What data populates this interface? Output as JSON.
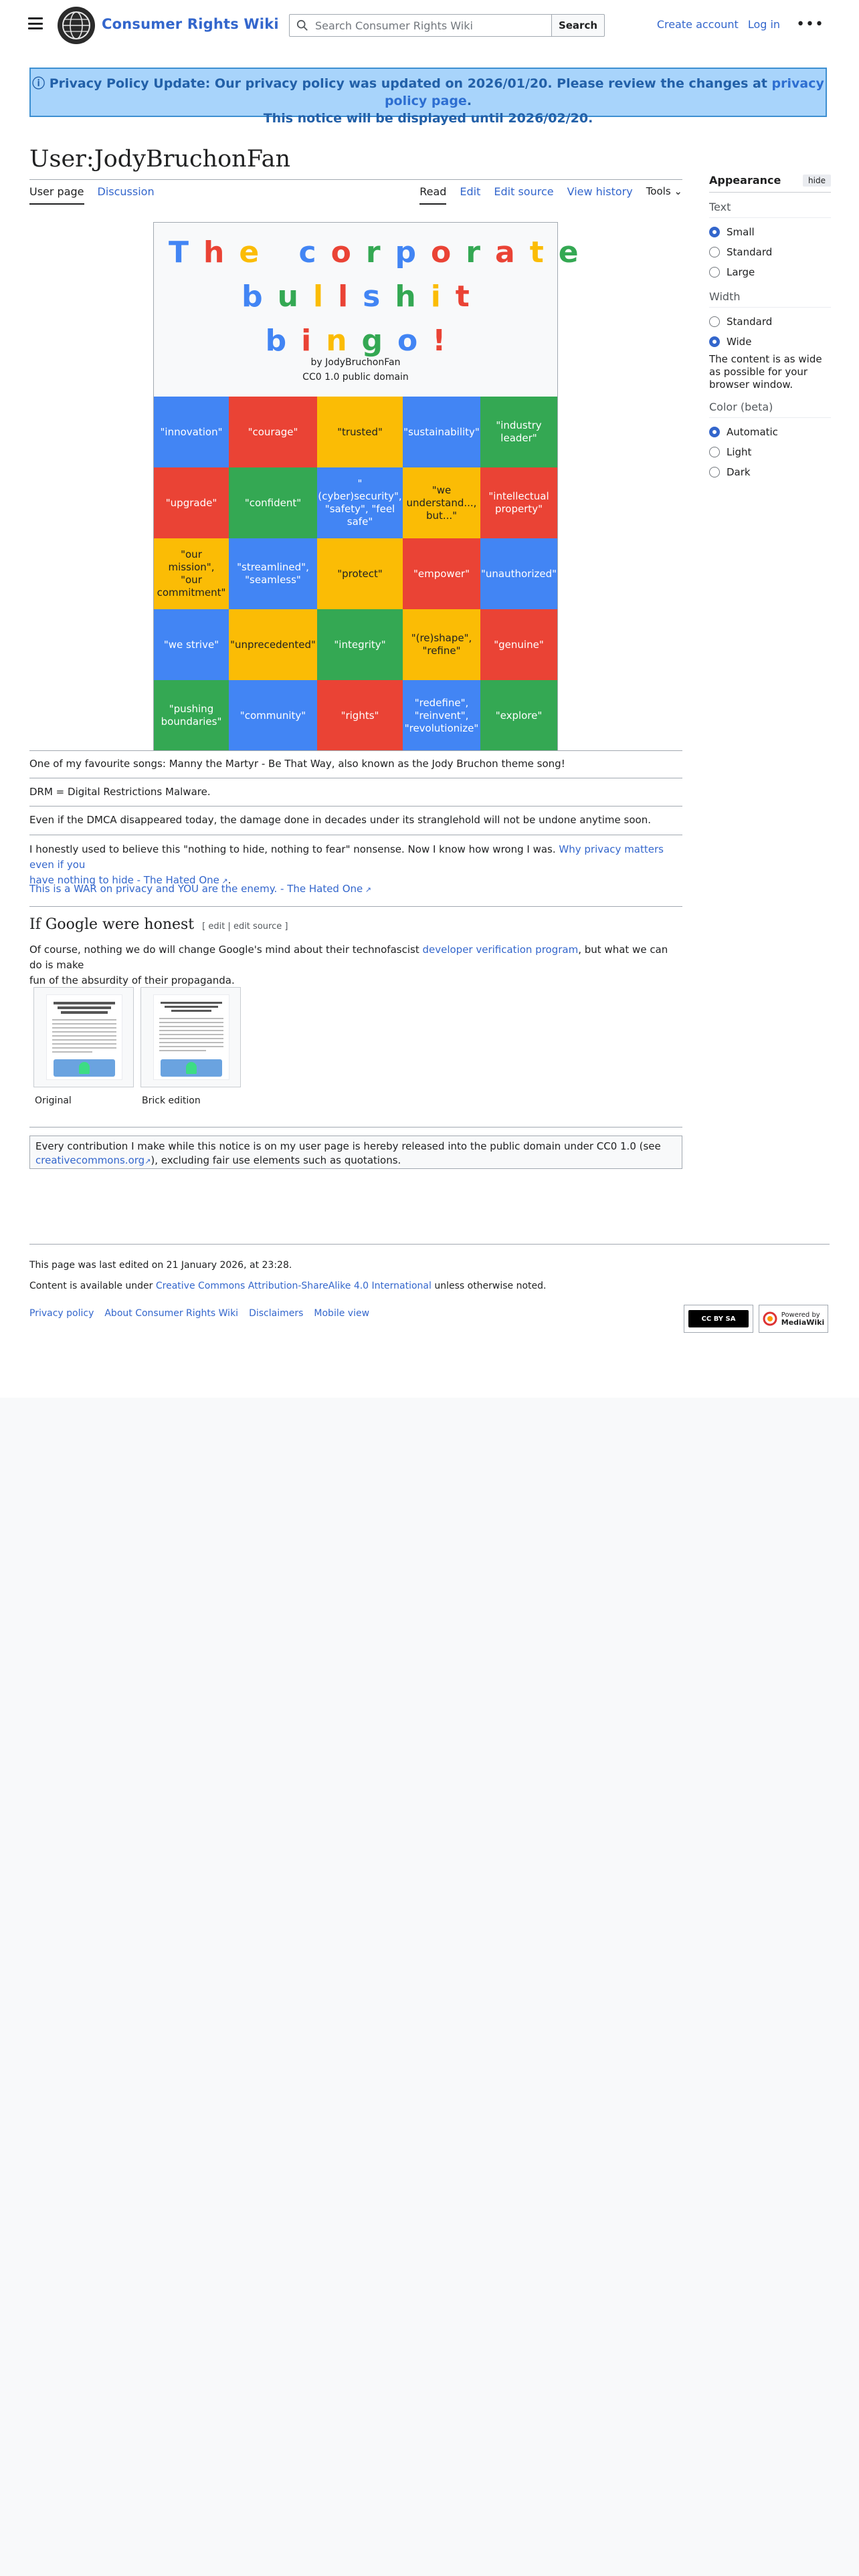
{
  "header": {
    "site_name": "Consumer Rights Wiki",
    "search_placeholder": "Search Consumer Rights Wiki",
    "search_button": "Search",
    "create_account": "Create account",
    "log_in": "Log in"
  },
  "notice": {
    "line1_prefix": "ⓘ Privacy Policy Update: Our privacy policy was updated on 2026/01/20. Please review the changes at ",
    "line1_link": "privacy policy page",
    "line1_suffix": ".",
    "line2": "This notice will be displayed until 2026/02/20."
  },
  "page": {
    "title": "User:JodyBruchonFan",
    "tabs_left": [
      "User page",
      "Discussion"
    ],
    "tabs_right": [
      "Read",
      "Edit",
      "Edit source",
      "View history"
    ],
    "tools": "Tools"
  },
  "appearance": {
    "title": "Appearance",
    "hide": "hide",
    "text_label": "Text",
    "text_options": [
      "Small",
      "Standard",
      "Large"
    ],
    "width_label": "Width",
    "width_options": [
      "Standard",
      "Wide"
    ],
    "width_note": "The content is as wide as possible for your browser window.",
    "color_label": "Color (beta)",
    "color_options": [
      "Automatic",
      "Light",
      "Dark"
    ]
  },
  "bingo": {
    "title_rows": [
      [
        [
          "T",
          "#4285f4"
        ],
        [
          "h",
          "#ea4335"
        ],
        [
          "e",
          "#fbbc05"
        ],
        [
          " ",
          ""
        ],
        [
          "c",
          "#4285f4"
        ],
        [
          "o",
          "#ea4335"
        ],
        [
          "r",
          "#34a853"
        ],
        [
          "p",
          "#4285f4"
        ],
        [
          "o",
          "#ea4335"
        ],
        [
          "r",
          "#34a853"
        ],
        [
          "a",
          "#ea4335"
        ],
        [
          "t",
          "#fbbc05"
        ],
        [
          "e",
          "#34a853"
        ]
      ],
      [
        [
          "b",
          "#4285f4"
        ],
        [
          "u",
          "#34a853"
        ],
        [
          "l",
          "#fbbc05"
        ],
        [
          "l",
          "#ea4335"
        ],
        [
          "s",
          "#4285f4"
        ],
        [
          "h",
          "#34a853"
        ],
        [
          "i",
          "#fbbc05"
        ],
        [
          "t",
          "#ea4335"
        ]
      ],
      [
        [
          "b",
          "#4285f4"
        ],
        [
          "i",
          "#ea4335"
        ],
        [
          "n",
          "#fbbc05"
        ],
        [
          "g",
          "#34a853"
        ],
        [
          "o",
          "#4285f4"
        ],
        [
          "!",
          "#ea4335"
        ]
      ]
    ],
    "author": "by JodyBruchonFan",
    "license": "CC0 1.0 public domain",
    "cells": [
      {
        "text": "\"innovation\"",
        "color": "#4285f4"
      },
      {
        "text": "\"courage\"",
        "color": "#ea4335"
      },
      {
        "text": "\"trusted\"",
        "color": "#fbbc05"
      },
      {
        "text": "\"sustainability\"",
        "color": "#4285f4"
      },
      {
        "text": "\"industry leader\"",
        "color": "#34a853"
      },
      {
        "text": "\"upgrade\"",
        "color": "#ea4335"
      },
      {
        "text": "\"confident\"",
        "color": "#34a853"
      },
      {
        "text": "\"(cyber)security\", \"safety\", \"feel safe\"",
        "color": "#4285f4"
      },
      {
        "text": "\"we understand..., but...\"",
        "color": "#fbbc05"
      },
      {
        "text": "\"intellectual property\"",
        "color": "#ea4335"
      },
      {
        "text": "\"our mission\", \"our commitment\"",
        "color": "#fbbc05"
      },
      {
        "text": "\"streamlined\", \"seamless\"",
        "color": "#4285f4"
      },
      {
        "text": "\"protect\"",
        "color": "#fbbc05"
      },
      {
        "text": "\"empower\"",
        "color": "#ea4335"
      },
      {
        "text": "\"unauthorized\"",
        "color": "#4285f4"
      },
      {
        "text": "\"we strive\"",
        "color": "#4285f4"
      },
      {
        "text": "\"unprecedented\"",
        "color": "#fbbc05"
      },
      {
        "text": "\"integrity\"",
        "color": "#34a853"
      },
      {
        "text": "\"(re)shape\", \"refine\"",
        "color": "#fbbc05"
      },
      {
        "text": "\"genuine\"",
        "color": "#ea4335"
      },
      {
        "text": "\"pushing boundaries\"",
        "color": "#34a853"
      },
      {
        "text": "\"community\"",
        "color": "#4285f4"
      },
      {
        "text": "\"rights\"",
        "color": "#ea4335"
      },
      {
        "text": "\"redefine\", \"reinvent\", \"revolutionize\"",
        "color": "#4285f4"
      },
      {
        "text": "\"explore\"",
        "color": "#34a853"
      }
    ]
  },
  "body": {
    "p1": "One of my favourite songs: Manny the Martyr - Be That Way, also known as the Jody Bruchon theme song!",
    "p2": "DRM = Digital Restrictions Malware.",
    "p3": "Even if the DMCA disappeared today, the damage done in decades under its stranglehold will not be undone anytime soon.",
    "p4_text": "I honestly used to believe this \"nothing to hide, nothing to fear\" nonsense. Now I know how wrong I was. ",
    "p4_link_a": "Why privacy matters even if you",
    "p4_link_b": "have nothing to hide - The Hated One",
    "p4_suffix": ".",
    "p5_link": "This is a WAR on privacy and YOU are the enemy. - The Hated One",
    "section_title": "If Google were honest",
    "section_edit": "[ edit | edit source ]",
    "p6_a": "Of course, nothing we do will change Google's mind about their technofascist ",
    "p6_link": "developer verification program",
    "p6_b": ", but what we can do is make",
    "p6_c": "fun of the absurdity of their propaganda.",
    "caption1": "Original",
    "caption2": "Brick edition",
    "cc_a": "Every contribution I make while this notice is on my user page is hereby released into the public domain under CC0 1.0 (see",
    "cc_link": "creativecommons.org",
    "cc_b": "), excluding fair use elements such as quotations."
  },
  "footer": {
    "last_edited": "This page was last edited on 21 January 2026, at 23:28.",
    "content_prefix": "Content is available under ",
    "content_link": "Creative Commons Attribution-ShareAlike 4.0 International",
    "content_suffix": " unless otherwise noted.",
    "links": [
      "Privacy policy",
      "About Consumer Rights Wiki",
      "Disclaimers",
      "Mobile view"
    ],
    "cc_badge": "CC BY SA",
    "mw_badge_a": "Powered by",
    "mw_badge_b": "MediaWiki"
  }
}
